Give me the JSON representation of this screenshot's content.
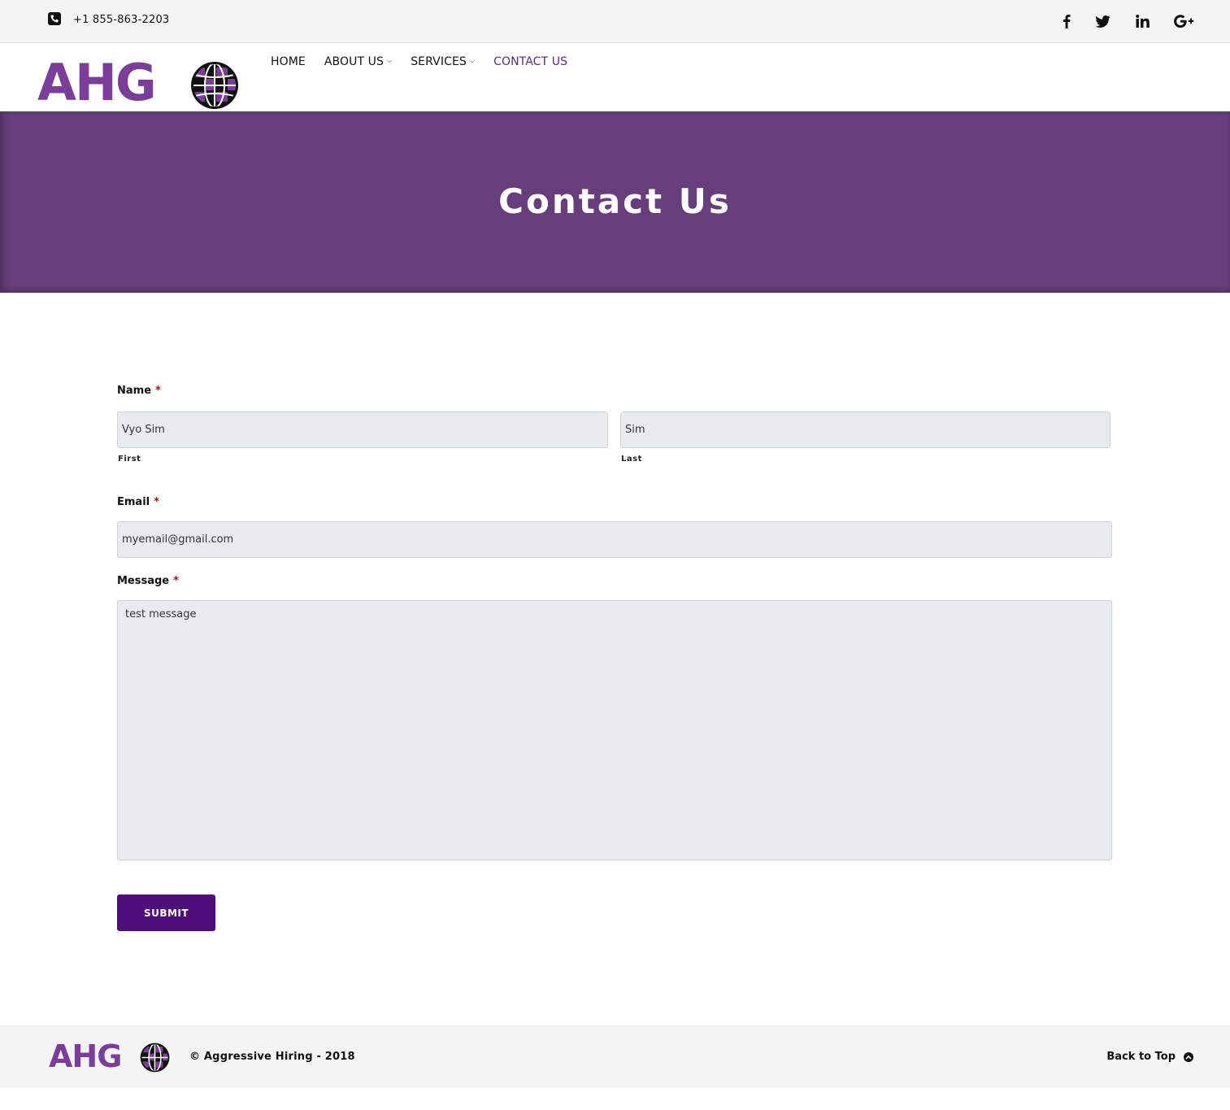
{
  "topbar": {
    "phone": "+1 855-863-2203",
    "social": [
      "facebook-icon",
      "twitter-icon",
      "linkedin-icon",
      "google-plus-icon"
    ]
  },
  "header": {
    "logo_text": "AHG",
    "nav": [
      {
        "label": "HOME",
        "dropdown": false
      },
      {
        "label": "ABOUT US",
        "dropdown": true
      },
      {
        "label": "SERVICES",
        "dropdown": true
      },
      {
        "label": "CONTACT US",
        "dropdown": false,
        "active": true
      }
    ]
  },
  "banner": {
    "title": "Contact Us"
  },
  "form": {
    "name_label": "Name",
    "required_mark": "*",
    "first_value": "Vyo Sim",
    "first_sublabel": "First",
    "last_value": "Sim",
    "last_sublabel": "Last",
    "email_label": "Email",
    "email_value": "myemail@gmail.com",
    "message_label": "Message",
    "message_value": "test message",
    "submit_label": "SUBMIT"
  },
  "footer": {
    "logo_text": "AHG",
    "copyright": "© Aggressive Hiring - 2018",
    "back_to_top": "Back to Top"
  },
  "colors": {
    "brand_purple": "#7a3d99",
    "banner_bg": "#673d7b",
    "submit_bg": "#4e0f7a",
    "active_nav": "#5a2a7c"
  }
}
